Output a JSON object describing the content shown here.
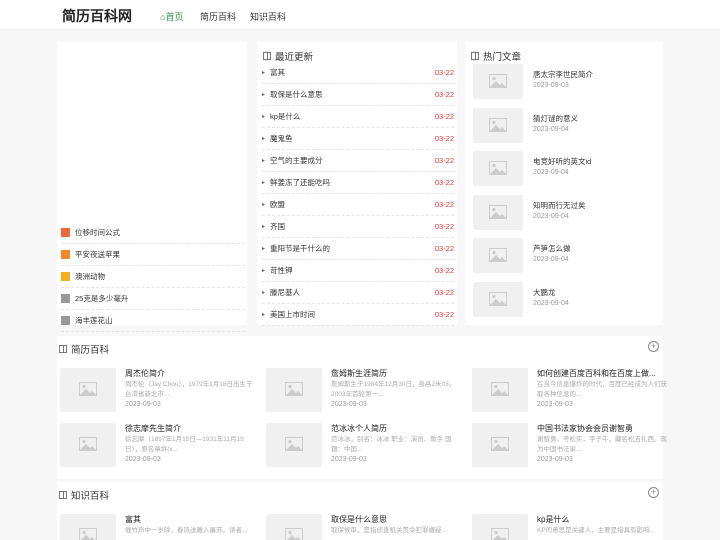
{
  "header": {
    "logo": "简历百科网",
    "nav": [
      {
        "label": "首页"
      },
      {
        "label": "简历百科"
      },
      {
        "label": "知识百科"
      }
    ]
  },
  "colors": {
    "accent": "#2e9e4f",
    "date_red": "#e33333",
    "rank": [
      "#ee6a3a",
      "#f28a2a",
      "#f5b021",
      "#999999",
      "#999999"
    ]
  },
  "rank_list": [
    "位移时间公式",
    "平安夜送苹果",
    "澳洲动物",
    "25克是多少毫升",
    "海丰莲花山"
  ],
  "latest": {
    "title": "最近更新",
    "items": [
      {
        "title": "富其",
        "date": "03-22"
      },
      {
        "title": "取保是什么意思",
        "date": "03-22"
      },
      {
        "title": "kp是什么",
        "date": "03-22"
      },
      {
        "title": "魔鬼鱼",
        "date": "03-22"
      },
      {
        "title": "空气的主要成分",
        "date": "03-22"
      },
      {
        "title": "鲜姜冻了还能吃吗",
        "date": "03-22"
      },
      {
        "title": "欧盟",
        "date": "03-22"
      },
      {
        "title": "齐国",
        "date": "03-22"
      },
      {
        "title": "重阳节是干什么的",
        "date": "03-22"
      },
      {
        "title": "苛性钾",
        "date": "03-22"
      },
      {
        "title": "滕尼基人",
        "date": "03-22"
      },
      {
        "title": "美国上市时间",
        "date": "03-22"
      }
    ]
  },
  "hot": {
    "title": "热门文章",
    "items": [
      {
        "title": "唐太宗李世民简介",
        "date": "2023-09-03"
      },
      {
        "title": "猜灯谜的意义",
        "date": "2023-09-04"
      },
      {
        "title": "电竞好听的英文id",
        "date": "2023-09-04"
      },
      {
        "title": "知明而行无过矣",
        "date": "2023-09-04"
      },
      {
        "title": "芦笋怎么做",
        "date": "2023-09-04"
      },
      {
        "title": "大鹏龙",
        "date": "2023-09-04"
      }
    ]
  },
  "resume": {
    "title": "简历百科",
    "cards": [
      {
        "title": "周杰伦简介",
        "desc": "周杰伦（Jay Chou），1979年1月18日出生于台湾省新北市...",
        "date": "2023-09-03"
      },
      {
        "title": "詹姆斯生涯简历",
        "desc": "詹姆斯生于1984年12月30日，身高2米03，2003年首轮第一...",
        "date": "2023-09-03"
      },
      {
        "title": "如何创建百度百科和在百度上做...",
        "desc": "在当今信息爆炸的时代，百度已经成为人们获取各种信息的...",
        "date": "2023-09-03"
      },
      {
        "title": "徐志摩先生简介",
        "desc": "徐志摩（1897年1月15日—1931年11月19日），原名章垿(x...",
        "date": "2023-09-03"
      },
      {
        "title": "范冰冰个人简历",
        "desc": "范冰冰，别名：冰冰 职业：演员、歌手 国籍：中国...",
        "date": "2023-09-03"
      },
      {
        "title": "中国书法家协会会员谢智勇",
        "desc": "谢智勇，号松实，字子午，藏名松吉扎西。现为中国书法家...",
        "date": "2023-09-03"
      }
    ]
  },
  "knowledge": {
    "title": "知识百科",
    "cards": [
      {
        "title": "富其",
        "desc": "缠竹声中一岁除，春风送暖入屠苏。读者...",
        "date": ""
      },
      {
        "title": "取保是什么意思",
        "desc": "取保候审，是指侦查机关责令犯罪嫌疑...",
        "date": ""
      },
      {
        "title": "kp是什么",
        "desc": "KP的意思是关键人，主要是指具有影响...",
        "date": ""
      }
    ]
  }
}
